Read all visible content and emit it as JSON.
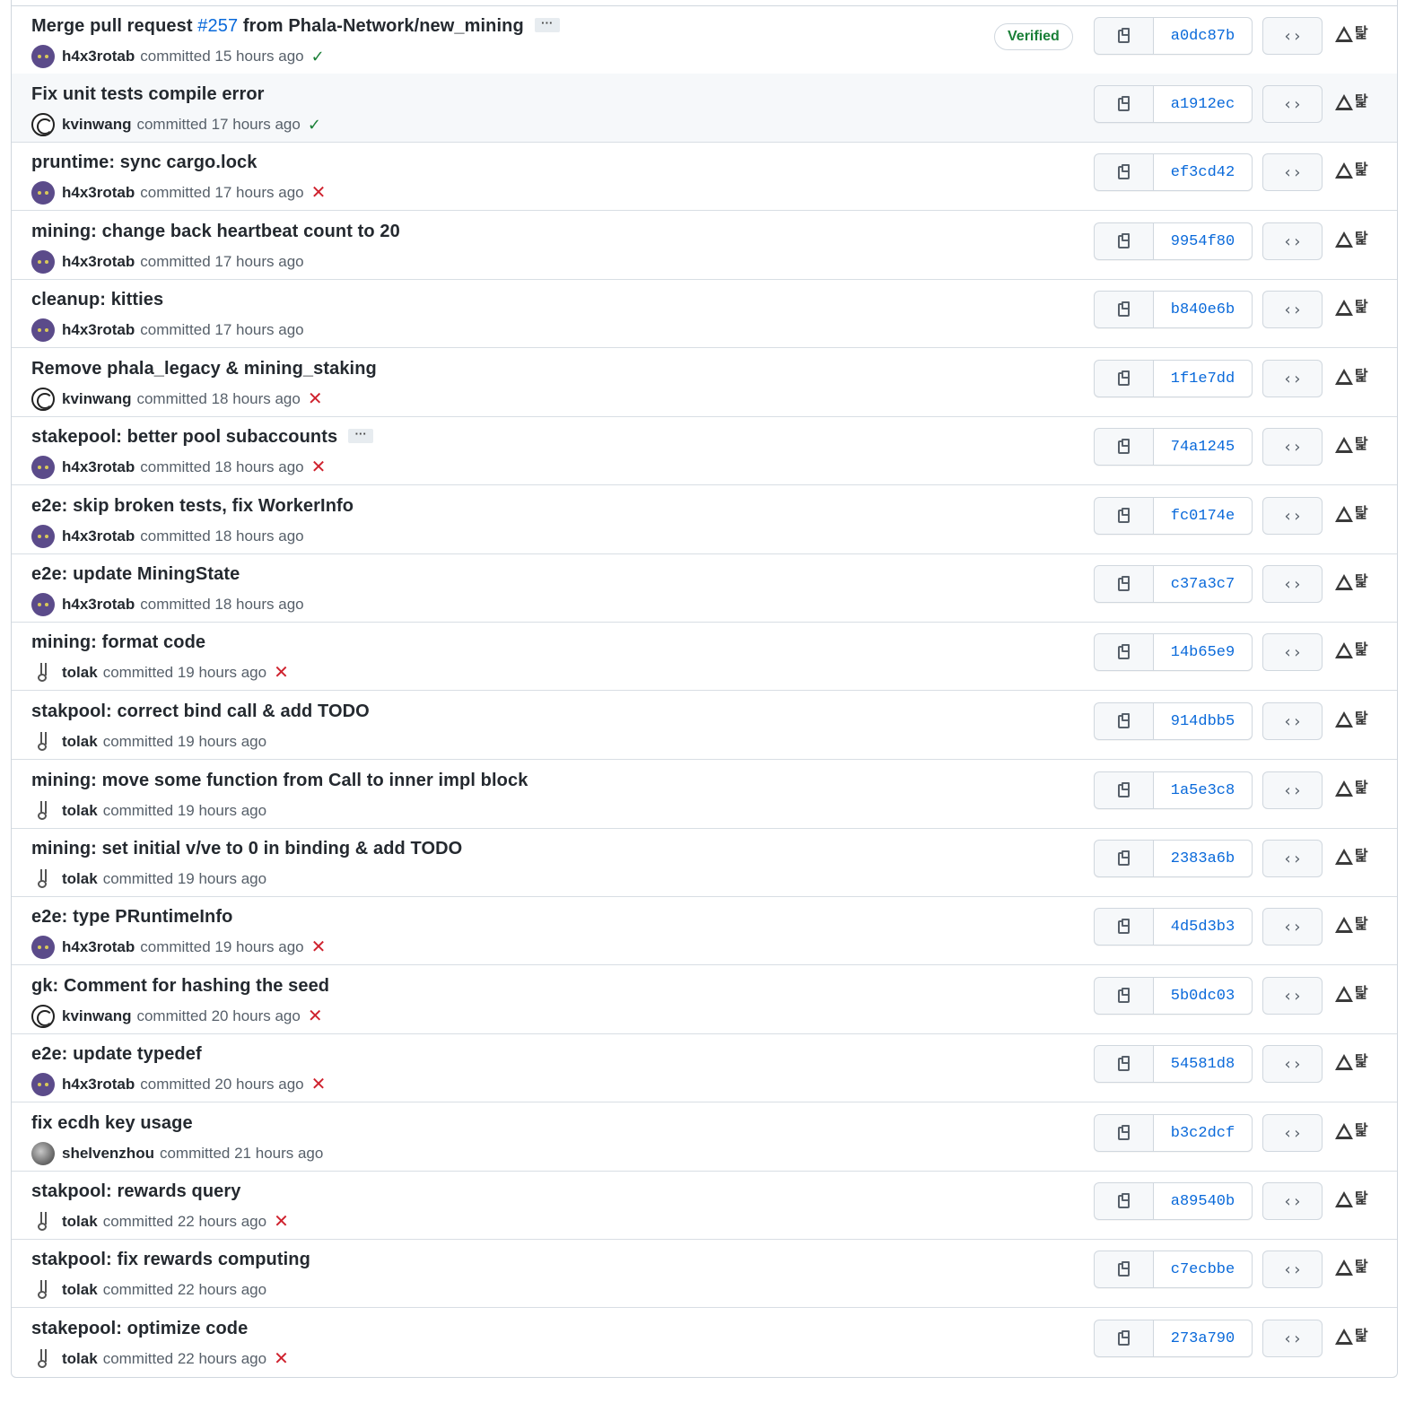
{
  "verified_label": "Verified",
  "commits": [
    {
      "pre": "Merge pull request ",
      "pr": "#257",
      "post": " from Phala-Network/new_mining",
      "more": true,
      "author": "h4x3rotab",
      "avatar": "cat",
      "time": "committed 15 hours ago",
      "status": "ok",
      "verified": true,
      "sha": "a0dc87b"
    },
    {
      "pre": "Fix unit tests compile error",
      "author": "kvinwang",
      "avatar": "face",
      "time": "committed 17 hours ago",
      "status": "ok",
      "highlight": true,
      "sha": "a1912ec"
    },
    {
      "pre": "pruntime: sync cargo.lock",
      "author": "h4x3rotab",
      "avatar": "cat",
      "time": "committed 17 hours ago",
      "status": "fail",
      "sha": "ef3cd42"
    },
    {
      "pre": "mining: change back heartbeat count to 20",
      "author": "h4x3rotab",
      "avatar": "cat",
      "time": "committed 17 hours ago",
      "status": "none",
      "sha": "9954f80"
    },
    {
      "pre": "cleanup: kitties",
      "author": "h4x3rotab",
      "avatar": "cat",
      "time": "committed 17 hours ago",
      "status": "none",
      "sha": "b840e6b"
    },
    {
      "pre": "Remove phala_legacy & mining_staking",
      "author": "kvinwang",
      "avatar": "face",
      "time": "committed 18 hours ago",
      "status": "fail",
      "sha": "1f1e7dd"
    },
    {
      "pre": "stakepool: better pool subaccounts",
      "more": true,
      "author": "h4x3rotab",
      "avatar": "cat",
      "time": "committed 18 hours ago",
      "status": "fail",
      "sha": "74a1245"
    },
    {
      "pre": "e2e: skip broken tests, fix WorkerInfo",
      "author": "h4x3rotab",
      "avatar": "cat",
      "time": "committed 18 hours ago",
      "status": "none",
      "sha": "fc0174e"
    },
    {
      "pre": "e2e: update MiningState",
      "author": "h4x3rotab",
      "avatar": "cat",
      "time": "committed 18 hours ago",
      "status": "none",
      "sha": "c37a3c7"
    },
    {
      "pre": "mining: format code",
      "author": "tolak",
      "avatar": "rabbit",
      "time": "committed 19 hours ago",
      "status": "fail",
      "sha": "14b65e9"
    },
    {
      "pre": "stakpool: correct bind call & add TODO",
      "author": "tolak",
      "avatar": "rabbit",
      "time": "committed 19 hours ago",
      "status": "none",
      "sha": "914dbb5"
    },
    {
      "pre": "mining: move some function from Call to inner impl block",
      "author": "tolak",
      "avatar": "rabbit",
      "time": "committed 19 hours ago",
      "status": "none",
      "sha": "1a5e3c8"
    },
    {
      "pre": "mining: set initial v/ve to 0 in binding & add TODO",
      "author": "tolak",
      "avatar": "rabbit",
      "time": "committed 19 hours ago",
      "status": "none",
      "sha": "2383a6b"
    },
    {
      "pre": "e2e: type PRuntimeInfo",
      "author": "h4x3rotab",
      "avatar": "cat",
      "time": "committed 19 hours ago",
      "status": "fail",
      "sha": "4d5d3b3"
    },
    {
      "pre": "gk: Comment for hashing the seed",
      "author": "kvinwang",
      "avatar": "face",
      "time": "committed 20 hours ago",
      "status": "fail",
      "sha": "5b0dc03"
    },
    {
      "pre": "e2e: update typedef",
      "author": "h4x3rotab",
      "avatar": "cat",
      "time": "committed 20 hours ago",
      "status": "fail",
      "sha": "54581d8"
    },
    {
      "pre": "fix ecdh key usage",
      "author": "shelvenzhou",
      "avatar": "photo",
      "time": "committed 21 hours ago",
      "status": "none",
      "sha": "b3c2dcf"
    },
    {
      "pre": "stakpool: rewards query",
      "author": "tolak",
      "avatar": "rabbit",
      "time": "committed 22 hours ago",
      "status": "fail",
      "sha": "a89540b"
    },
    {
      "pre": "stakpool: fix rewards computing",
      "author": "tolak",
      "avatar": "rabbit",
      "time": "committed 22 hours ago",
      "status": "none",
      "sha": "c7ecbbe"
    },
    {
      "pre": "stakepool: optimize code",
      "author": "tolak",
      "avatar": "rabbit",
      "time": "committed 22 hours ago",
      "status": "fail",
      "sha": "273a790"
    }
  ]
}
